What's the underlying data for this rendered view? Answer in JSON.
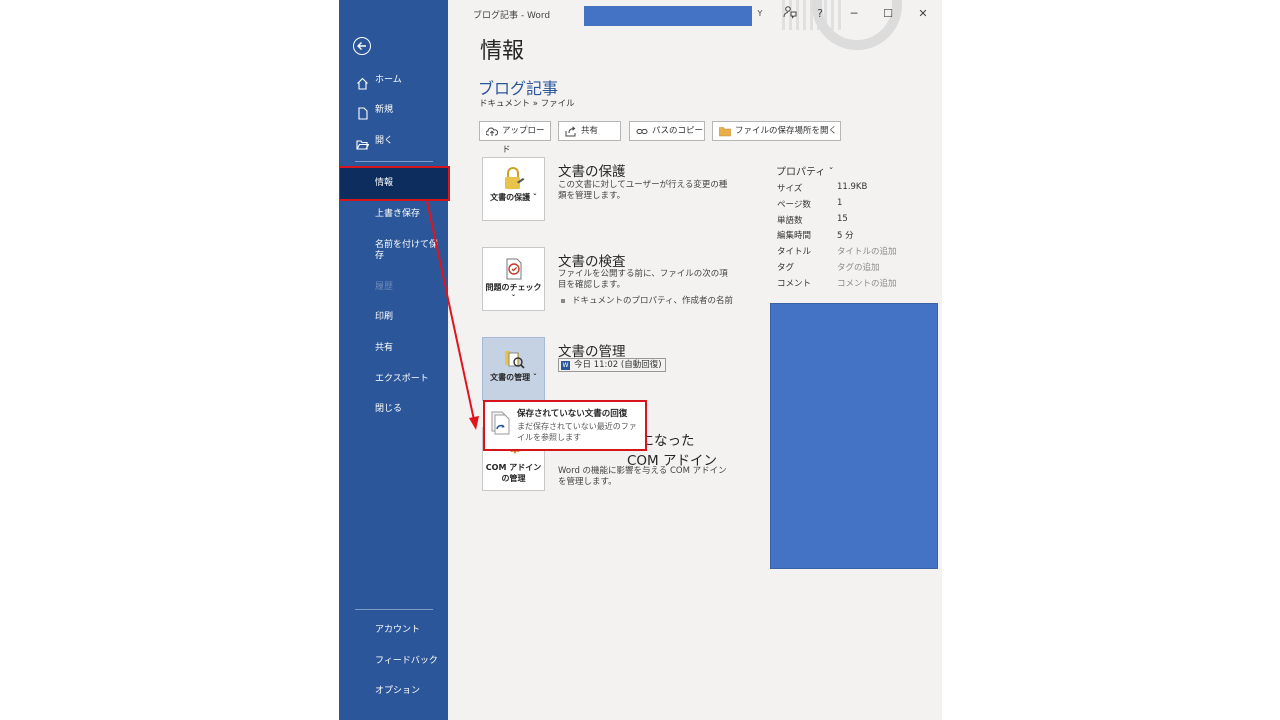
{
  "window": {
    "title": "ブログ記事 - Word",
    "redacted_label": "Y"
  },
  "sidebar": {
    "items_top": [
      {
        "label": "ホーム",
        "icon": "home-icon"
      },
      {
        "label": "新規",
        "icon": "new-document-icon"
      },
      {
        "label": "開く",
        "icon": "open-folder-icon"
      }
    ],
    "items_mid": [
      {
        "label": "情報",
        "state": "active"
      },
      {
        "label": "上書き保存"
      },
      {
        "label": "名前を付けて保存"
      },
      {
        "label": "履歴",
        "state": "disabled"
      },
      {
        "label": "印刷"
      },
      {
        "label": "共有"
      },
      {
        "label": "エクスポート"
      },
      {
        "label": "閉じる"
      }
    ],
    "items_bottom": [
      {
        "label": "アカウント"
      },
      {
        "label": "フィードバック"
      },
      {
        "label": "オプション"
      }
    ]
  },
  "main": {
    "page_title": "情報",
    "doc_title": "ブログ記事",
    "breadcrumb": "ドキュメント » ファイル",
    "actions": [
      {
        "label": "アップロード",
        "icon": "upload-icon"
      },
      {
        "label": "共有",
        "icon": "share-icon"
      },
      {
        "label": "パスのコピー",
        "icon": "link-icon"
      },
      {
        "label": "ファイルの保存場所を開く",
        "icon": "folder-icon"
      }
    ],
    "sections": [
      {
        "card_label": "文書の保護 ˇ",
        "heading": "文書の保護",
        "text": "この文書に対してユーザーが行える変更の種類を管理します。",
        "icon": "lock-key-icon"
      },
      {
        "card_label": "問題のチェック ˇ",
        "heading": "文書の検査",
        "text": "ファイルを公開する前に、ファイルの次の項目を確認します。",
        "bullet": "ドキュメントのプロパティ、作成者の名前",
        "icon": "inspect-document-icon"
      },
      {
        "card_label": "文書の管理 ˇ",
        "heading": "文書の管理",
        "version": "今日 11:02 (自動回復)",
        "icon": "manage-document-icon"
      },
      {
        "card_label": "COM アドインの管理",
        "heading": "効になった COM アドイン",
        "text": "Word の機能に影響を与える COM アドインを管理します。",
        "icon": "com-addin-icon"
      }
    ],
    "popup": {
      "title": "保存されていない文書の回復",
      "description": "まだ保存されていない最近のファイルを参照します",
      "icon": "recover-document-icon"
    }
  },
  "properties": {
    "header": "プロパティ ˇ",
    "rows": [
      {
        "label": "サイズ",
        "value": "11.9KB"
      },
      {
        "label": "ページ数",
        "value": "1"
      },
      {
        "label": "単語数",
        "value": "15"
      },
      {
        "label": "編集時間",
        "value": "5 分"
      },
      {
        "label": "タイトル",
        "value": "タイトルの追加",
        "placeholder": true
      },
      {
        "label": "タグ",
        "value": "タグの追加",
        "placeholder": true
      },
      {
        "label": "コメント",
        "value": "コメントの追加",
        "placeholder": true
      }
    ]
  },
  "colors": {
    "sidebar": "#2b579a",
    "active": "#0c2d5e",
    "highlight": "#d6141b",
    "redaction": "#4472c4"
  }
}
